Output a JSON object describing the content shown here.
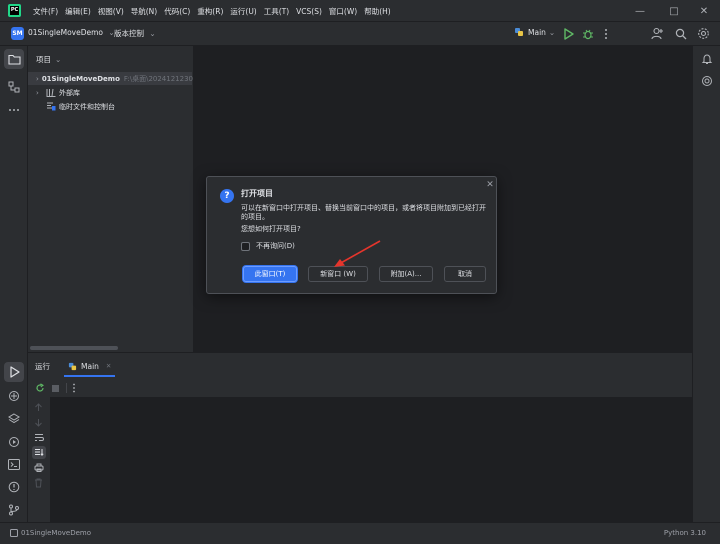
{
  "menu": [
    "文件(F)",
    "编辑(E)",
    "视图(V)",
    "导航(N)",
    "代码(C)",
    "重构(R)",
    "运行(U)",
    "工具(T)",
    "VCS(S)",
    "窗口(W)",
    "帮助(H)"
  ],
  "app_logo": "PC",
  "window_controls": {
    "minimize": "—",
    "maximize": "□",
    "close": "✕"
  },
  "toolbar": {
    "project_badge": "SM",
    "project_name": "01SingleMoveDemo",
    "vcs": "版本控制",
    "run_config": "Main"
  },
  "project_panel": {
    "title": "项目",
    "items": [
      {
        "label": "01SingleMoveDemo",
        "path": "F:\\桌面\\2024121230"
      },
      {
        "label": "外部库"
      },
      {
        "label": "临时文件和控制台"
      }
    ]
  },
  "run_panel": {
    "title": "运行",
    "tab": "Main",
    "tab_close": "✕"
  },
  "status_bar": {
    "project": "01SingleMoveDemo",
    "interpreter": "Python 3.10"
  },
  "dialog": {
    "icon": "?",
    "close": "✕",
    "title": "打开项目",
    "message": "可以在新窗口中打开项目、替换当前窗口中的项目，或者将项目附加到已经打开的项目。",
    "question": "您想如何打开项目?",
    "checkbox_label": "不再询问(D)",
    "buttons": {
      "this_window": "此窗口(T)",
      "new_window": "新窗口 (W)",
      "attach": "附加(A)...",
      "cancel": "取消"
    }
  },
  "colors": {
    "accent": "#3574f0",
    "run_green": "#5fb865",
    "annotation_arrow": "#e5352c"
  }
}
